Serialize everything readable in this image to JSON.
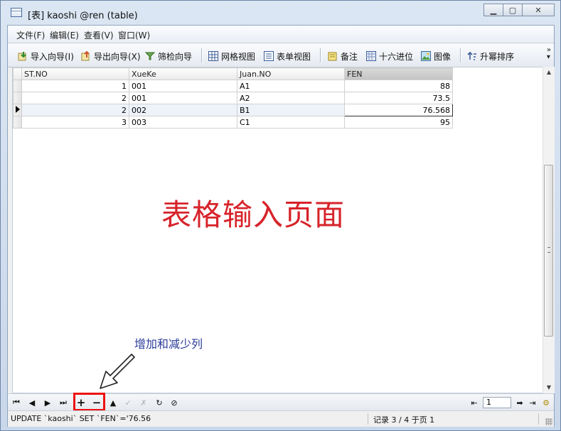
{
  "window": {
    "title": "[表] kaoshi @ren (table)",
    "controls": [
      "minimize",
      "maximize",
      "close"
    ]
  },
  "menu": [
    "文件(F)",
    "编辑(E)",
    "查看(V)",
    "窗口(W)"
  ],
  "toolbar": {
    "items": [
      {
        "label": "导入向导(I)",
        "icon": "import-icon"
      },
      {
        "label": "导出向导(X)",
        "icon": "export-icon"
      },
      {
        "label": "筛检向导",
        "icon": "filter-wizard-icon"
      },
      {
        "label": "网格视图",
        "icon": "grid-view-icon"
      },
      {
        "label": "表单视图",
        "icon": "form-view-icon"
      },
      {
        "label": "备注",
        "icon": "memo-icon"
      },
      {
        "label": "十六进位",
        "icon": "hex-icon"
      },
      {
        "label": "图像",
        "icon": "image-icon"
      },
      {
        "label": "升幂排序",
        "icon": "sort-asc-icon"
      }
    ]
  },
  "grid": {
    "columns": [
      "ST.NO",
      "XueKe",
      "Juan.NO",
      "FEN"
    ],
    "selected_column": "FEN",
    "rows": [
      {
        "st_no": "1",
        "xueke": "001",
        "juan_no": "A1",
        "fen": "88"
      },
      {
        "st_no": "2",
        "xueke": "001",
        "juan_no": "A2",
        "fen": "73.5"
      },
      {
        "st_no": "2",
        "xueke": "002",
        "juan_no": "B1",
        "fen": "76.568"
      },
      {
        "st_no": "3",
        "xueke": "003",
        "juan_no": "C1",
        "fen": "95"
      }
    ],
    "current_row": 3
  },
  "annotations": {
    "main": "表格输入页面",
    "arrow_note": "增加和减少列"
  },
  "navigation": {
    "page_value": "1"
  },
  "status": {
    "sql": "UPDATE `kaoshi` SET `FEN`='76.56",
    "records": "记录 3 / 4 于页 1"
  },
  "colors": {
    "annotation_red": "#d7232a",
    "annotation_blue": "#2a3b9a",
    "highlight_box": "#ee1111"
  }
}
